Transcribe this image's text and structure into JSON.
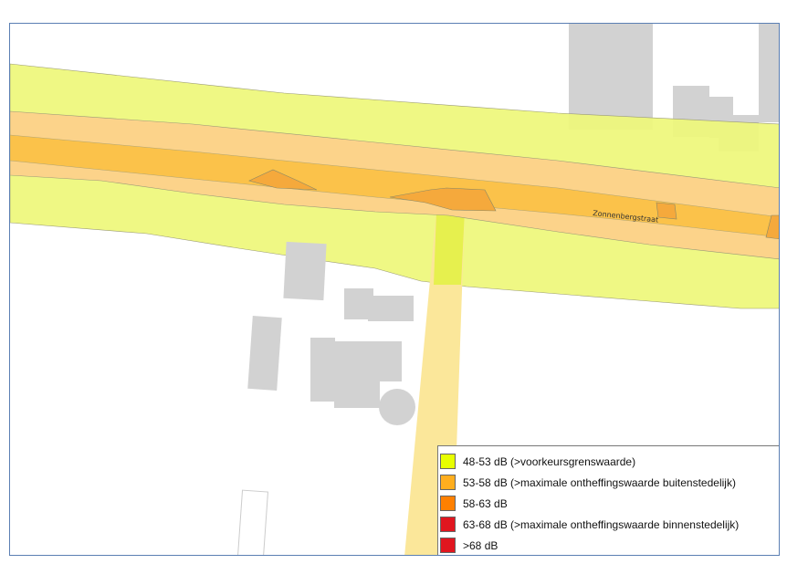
{
  "map": {
    "street_name": "Zonnenbergstraat",
    "colors": {
      "buildings": "#d2d2d2",
      "band_48_53": "#eef77a",
      "band_53_58": "#fcd38a",
      "band_58_63": "#fbc24a",
      "hotspot": "#f5a93c",
      "side_road": "#fbe79a"
    }
  },
  "legend": {
    "items": [
      {
        "label": "48-53 dB (>voorkeursgrenswaarde)",
        "color": "#e8ff00"
      },
      {
        "label": "53-58 dB (>maximale ontheffingswaarde buitenstedelijk)",
        "color": "#ffae1e"
      },
      {
        "label": "58-63 dB",
        "color": "#ff8000"
      },
      {
        "label": "63-68 dB (>maximale ontheffingswaarde binnenstedelijk)",
        "color": "#e0161f"
      },
      {
        "label": ">68 dB",
        "color": "#e0161f"
      }
    ]
  }
}
